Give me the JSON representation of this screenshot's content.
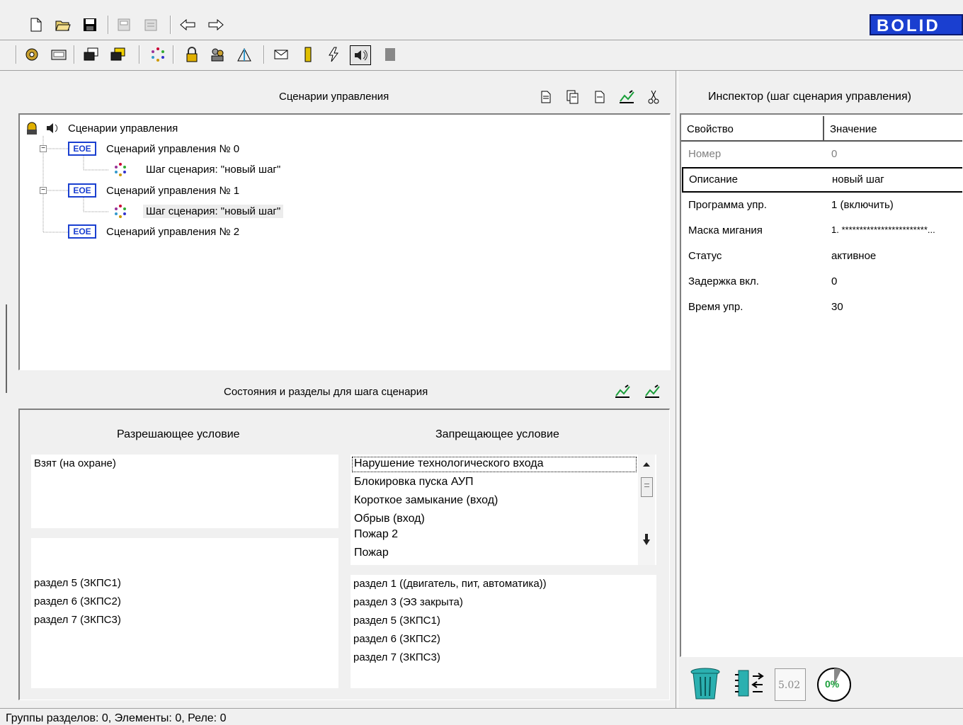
{
  "brand": {
    "logo_text": "BOLID"
  },
  "scenarios": {
    "title": "Сценарии управления",
    "tree": [
      {
        "label": "Сценарии управления"
      },
      {
        "label": "Сценарий управления № 0",
        "badge": "EOE"
      },
      {
        "label": "Шаг сценария: \"новый шаг\""
      },
      {
        "label": "Сценарий управления № 1",
        "badge": "EOE"
      },
      {
        "label": "Шаг сценария: \"новый шаг\""
      },
      {
        "label": "Сценарий управления № 2",
        "badge": "EOE"
      }
    ]
  },
  "states": {
    "title": "Состояния и разделы для шага сценария",
    "allow": {
      "header": "Разрешающее условие",
      "conditions": [
        "Взят (на охране)"
      ],
      "sections": [
        "раздел 5 (ЗКПС1)",
        "раздел 6 (ЗКПС2)",
        "раздел 7 (ЗКПС3)"
      ]
    },
    "deny": {
      "header": "Запрещающее условие",
      "conditions": [
        "Нарушение технологического входа",
        "Блокировка пуска АУП",
        "Короткое замыкание (вход)",
        "Обрыв (вход)",
        "Пожар 2",
        "Пожар"
      ],
      "sections": [
        "раздел 1 ((двигатель, пит, автоматика))",
        "раздел 3 (ЭЗ закрыта)",
        "раздел 5 (ЗКПС1)",
        "раздел 6 (ЗКПС2)",
        "раздел 7 (ЗКПС3)"
      ]
    }
  },
  "inspector": {
    "title": "Инспектор (шаг сценария управления)",
    "col_property": "Свойство",
    "col_value": "Значение",
    "rows": [
      {
        "key": "Номер",
        "value": "0"
      },
      {
        "key": "Описание",
        "value": "новый шаг"
      },
      {
        "key": "Программа упр.",
        "value": "1 (включить)"
      },
      {
        "key": "Маска мигания",
        "value": "1. ************************..."
      },
      {
        "key": "Статус",
        "value": "активное"
      },
      {
        "key": "Задержка вкл.",
        "value": "0"
      },
      {
        "key": "Время упр.",
        "value": "30"
      }
    ]
  },
  "bottom_icons": {
    "version": "5.02",
    "progress": "0%"
  },
  "status_bar": {
    "text": "Группы разделов: 0, Элементы: 0, Реле: 0"
  },
  "colors": {
    "brand_blue": "#1a3fd0",
    "icon_green": "#1a9f3a",
    "text_gray": "#808080"
  }
}
